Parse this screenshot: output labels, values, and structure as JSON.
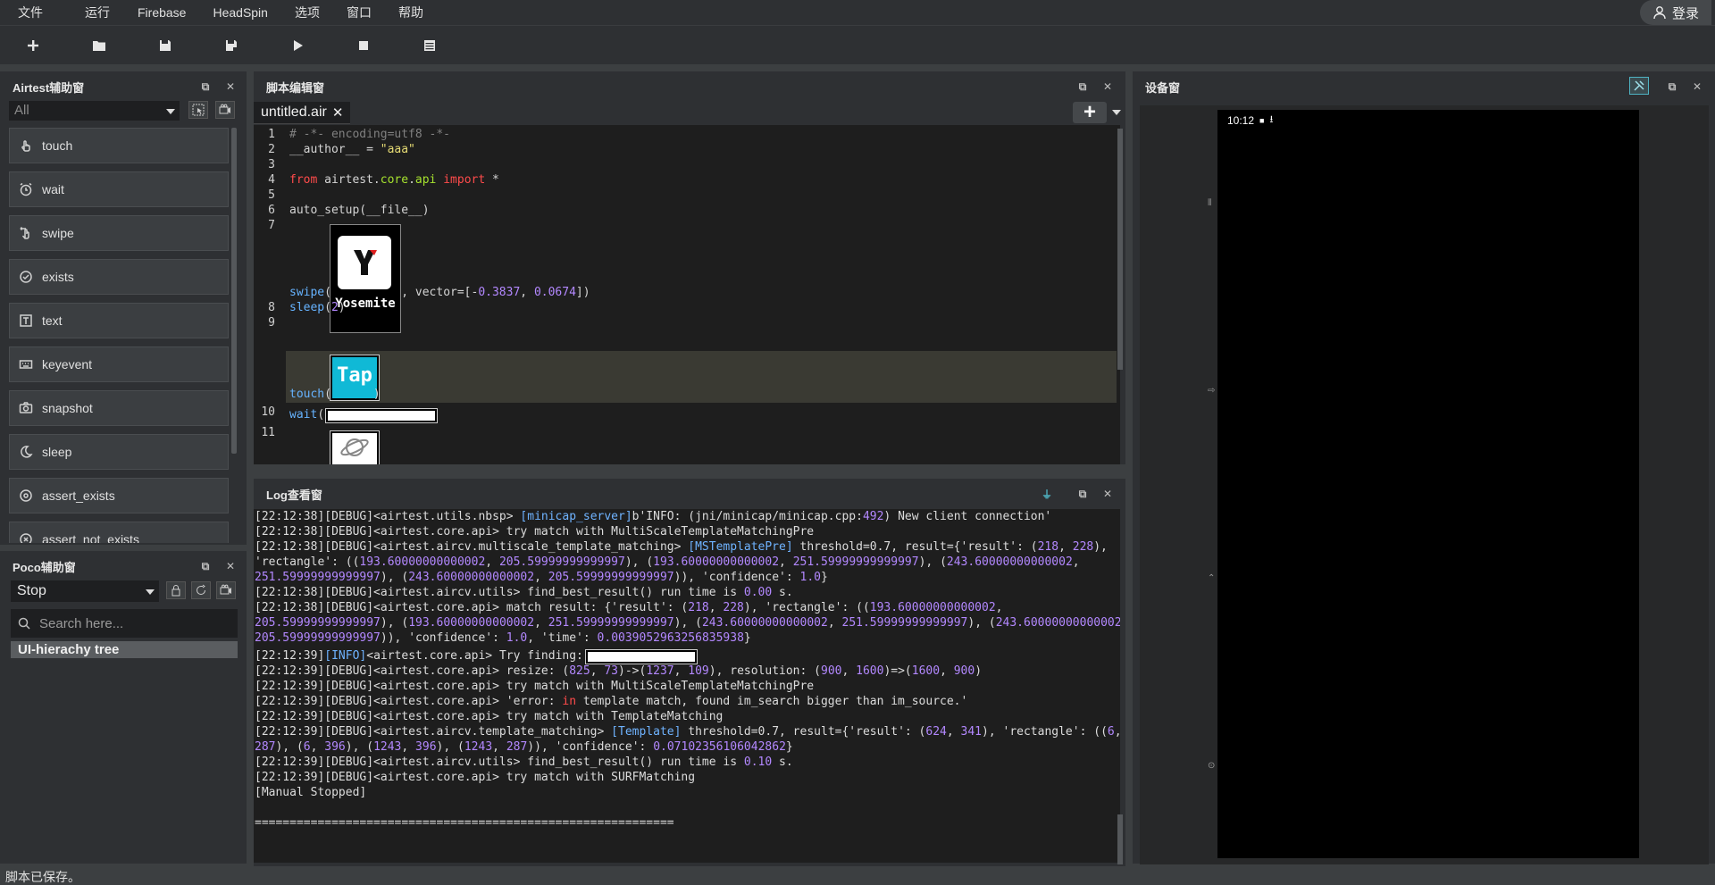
{
  "menu": [
    "文件",
    "运行",
    "Firebase",
    "HeadSpin",
    "选项",
    "窗口",
    "帮助"
  ],
  "login_label": "登录",
  "toolbar": [
    "new",
    "open",
    "save",
    "save-as",
    "run",
    "stop",
    "log"
  ],
  "airtest_panel": {
    "title": "Airtest辅助窗",
    "filter": "All",
    "items": [
      {
        "label": "touch",
        "icon": "hand-pointer-icon"
      },
      {
        "label": "wait",
        "icon": "alarm-icon"
      },
      {
        "label": "swipe",
        "icon": "swipe-hand-icon"
      },
      {
        "label": "exists",
        "icon": "check-circle-icon"
      },
      {
        "label": "text",
        "icon": "text-icon"
      },
      {
        "label": "keyevent",
        "icon": "keyboard-icon"
      },
      {
        "label": "snapshot",
        "icon": "camera-icon"
      },
      {
        "label": "sleep",
        "icon": "moon-icon"
      },
      {
        "label": "assert_exists",
        "icon": "target-icon"
      },
      {
        "label": "assert_not_exists",
        "icon": "target-x-icon"
      }
    ]
  },
  "poco_panel": {
    "title": "Poco辅助窗",
    "select": "Stop",
    "search_placeholder": "Search here...",
    "tree_label": "UI-hierachy tree"
  },
  "editor": {
    "title": "脚本编辑窗",
    "tab": "untitled.air",
    "thumb_yosemite": "Yosemite",
    "thumb_tap": "Tap"
  },
  "log": {
    "title": "Log查看窗"
  },
  "device": {
    "title": "设备窗",
    "time": "10:12"
  },
  "status": "脚本已保存。",
  "colors": {
    "accent": "#4fb3c3",
    "background": "#2e3033",
    "editor_bg": "#1e1e1e"
  }
}
